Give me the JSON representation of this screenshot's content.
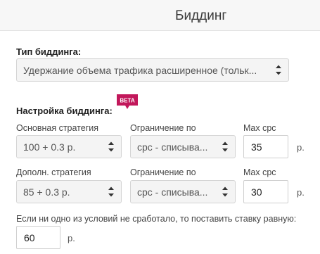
{
  "header": {
    "title": "Биддинг"
  },
  "bidding_type": {
    "label": "Тип биддинга:",
    "selected": "Удержание объема трафика расширенное (тольк..."
  },
  "bidding_settings": {
    "label": "Настройка биддинга:",
    "badge": "BETA",
    "primary": {
      "strategy_label": "Основная стратегия",
      "strategy_value": "100 + 0.3 р.",
      "limit_label": "Ограничение по",
      "limit_value": "cpc - списыва...",
      "max_label": "Max cpc",
      "max_value": "35",
      "unit": "р."
    },
    "secondary": {
      "strategy_label": "Дополн. стратегия",
      "strategy_value": "85 + 0.3 р.",
      "limit_label": "Ограничение по",
      "limit_value": "cpc - списыва...",
      "max_label": "Max cpc",
      "max_value": "30",
      "unit": "р."
    }
  },
  "fallback": {
    "label": "Если ни одно из условий не сработало, то поставить ставку равную:",
    "value": "60",
    "unit": "р."
  },
  "colors": {
    "badge": "#c2185b",
    "header_bg": "#f7f7f7",
    "select_bg": "#f4f4f4"
  },
  "icons": {
    "select_arrows": "up-down-arrows-icon"
  }
}
